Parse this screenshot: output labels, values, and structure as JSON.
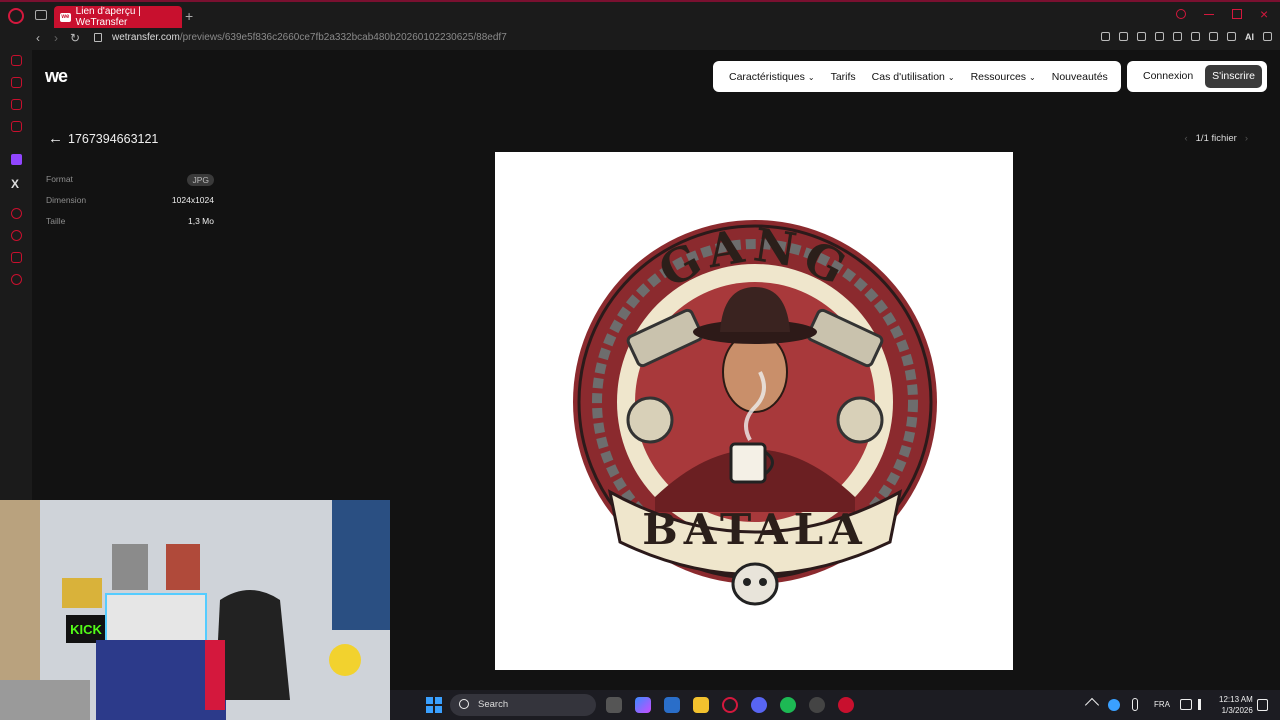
{
  "browser": {
    "tab_title": "Lien d'aperçu | WeTransfer",
    "tab_favicon": "we",
    "new_tab": "+",
    "url_host": "wetransfer.com",
    "url_path": "/previews/639e5f836c2660ce7fb2a332bcab480b20260102230625/88edf7",
    "ai_label": "AI"
  },
  "site": {
    "logo": "we",
    "nav": [
      {
        "label": "Caractéristiques",
        "has_dropdown": true
      },
      {
        "label": "Tarifs",
        "has_dropdown": false
      },
      {
        "label": "Cas d'utilisation",
        "has_dropdown": true
      },
      {
        "label": "Ressources",
        "has_dropdown": true
      },
      {
        "label": "Nouveautés",
        "has_dropdown": false
      }
    ],
    "login_label": "Connexion",
    "signup_label": "S'inscrire"
  },
  "file": {
    "title": "1767394663121",
    "meta": [
      {
        "key": "Format",
        "value": "JPG",
        "badge": true
      },
      {
        "key": "Dimension",
        "value": "1024x1024",
        "badge": false
      },
      {
        "key": "Taille",
        "value": "1,3 Mo",
        "badge": false
      }
    ],
    "pager": "1/1 fichier"
  },
  "preview_image": {
    "text_top": "GANG",
    "text_bottom": "BATALA"
  },
  "webcam": {
    "sign_text": "KICK"
  },
  "taskbar": {
    "search_label": "Search",
    "language": "FRA",
    "time": "12:13 AM",
    "date": "1/3/2026"
  },
  "colors": {
    "accent": "#c8102e",
    "page_bg": "#121212",
    "emblem_red": "#8b2a2e",
    "emblem_cream": "#efe6cc"
  }
}
